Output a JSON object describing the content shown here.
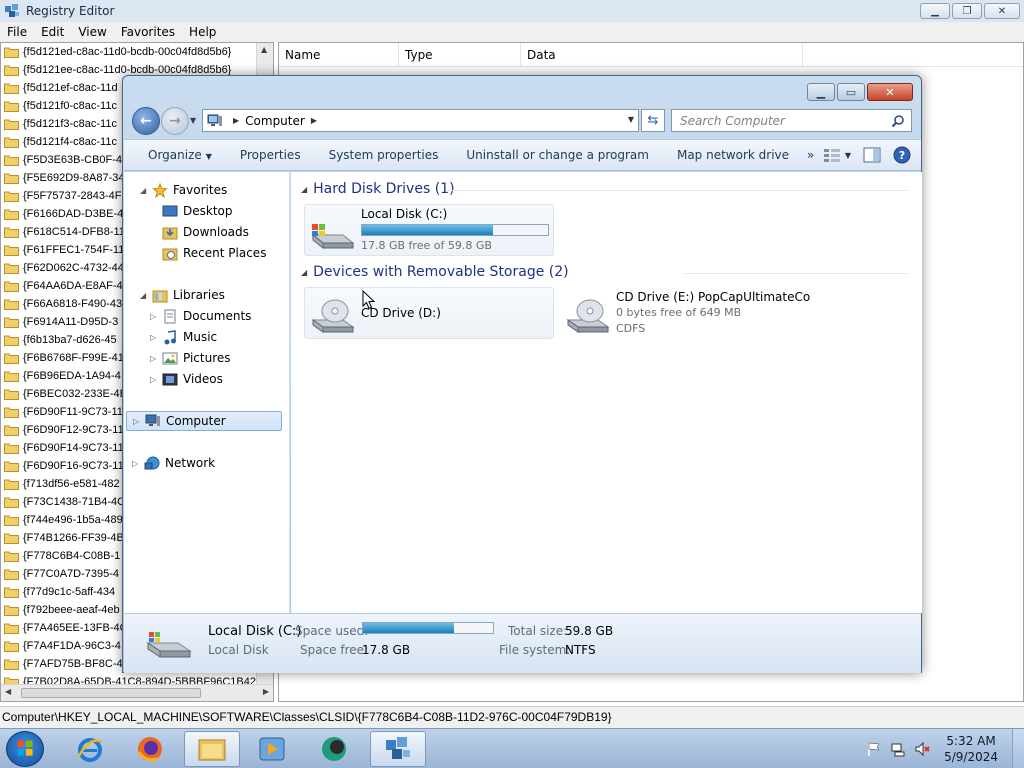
{
  "regedit": {
    "title": "Registry Editor",
    "menu": [
      "File",
      "Edit",
      "View",
      "Favorites",
      "Help"
    ],
    "tree_items": [
      "{f5d121ed-c8ac-11d0-bcdb-00c04fd8d5b6}",
      "{f5d121ee-c8ac-11d0-bcdb-00c04fd8d5b6}",
      "{f5d121ef-c8ac-11d",
      "{f5d121f0-c8ac-11c",
      "{f5d121f3-c8ac-11c",
      "{f5d121f4-c8ac-11c",
      "{F5D3E63B-CB0F-4(",
      "{F5E692D9-8A87-34",
      "{F5F75737-2843-4F",
      "{F6166DAD-D3BE-4",
      "{F618C514-DFB8-11",
      "{F61FFEC1-754F-11",
      "{F62D062C-4732-44",
      "{F64AA6DA-E8AF-4",
      "{F66A6818-F490-43",
      "{F6914A11-D95D-3",
      "{f6b13ba7-d626-45",
      "{F6B6768F-F99E-41",
      "{F6B96EDA-1A94-4",
      "{F6BEC032-233E-4E",
      "{F6D90F11-9C73-11",
      "{F6D90F12-9C73-11",
      "{F6D90F14-9C73-11",
      "{F6D90F16-9C73-11",
      "{f713df56-e581-482",
      "{F73C1438-71B4-4C",
      "{f744e496-1b5a-489",
      "{F74B1266-FF39-4B",
      "{F778C6B4-C08B-1",
      "{F77C0A7D-7395-4",
      "{f77d9c1c-5aff-434",
      "{f792beee-aeaf-4eb",
      "{F7A465EE-13FB-4C",
      "{F7A4F1DA-96C3-4",
      "{F7AFD75B-BF8C-4",
      "{F7B02D8A-65DB-41C8-894D-5BBBF96C1B42"
    ],
    "list_columns": [
      "Name",
      "Type",
      "Data"
    ],
    "status_path": "Computer\\HKEY_LOCAL_MACHINE\\SOFTWARE\\Classes\\CLSID\\{F778C6B4-C08B-11D2-976C-00C04F79DB19}"
  },
  "explorer": {
    "address": "Computer",
    "search_placeholder": "Search Computer",
    "toolbar": [
      "Organize",
      "Properties",
      "System properties",
      "Uninstall or change a program",
      "Map network drive"
    ],
    "toolbar_overflow": "»",
    "nav": {
      "favorites": "Favorites",
      "desktop": "Desktop",
      "downloads": "Downloads",
      "recent": "Recent Places",
      "libraries": "Libraries",
      "documents": "Documents",
      "music": "Music",
      "pictures": "Pictures",
      "videos": "Videos",
      "computer": "Computer",
      "network": "Network"
    },
    "groups": {
      "hdd": "Hard Disk Drives (1)",
      "removable": "Devices with Removable Storage (2)"
    },
    "drives": {
      "c": {
        "name": "Local Disk (C:)",
        "free": "17.8 GB free of 59.8 GB",
        "used_fraction": 0.702
      },
      "d": {
        "name": "CD Drive (D:)"
      },
      "e": {
        "name": "CD Drive (E:) PopCapUltimateCo",
        "free": "0 bytes free of 649 MB",
        "fs": "CDFS"
      }
    },
    "details": {
      "name": "Local Disk (C:)",
      "type": "Local Disk",
      "space_used_label": "Space used:",
      "space_free_label": "Space free:",
      "space_free": "17.8 GB",
      "total_size_label": "Total size:",
      "total_size": "59.8 GB",
      "file_system_label": "File system:",
      "file_system": "NTFS",
      "used_fraction": 0.702
    }
  },
  "taskbar": {
    "time": "5:32 AM",
    "date": "5/9/2024"
  },
  "colors": {
    "group_header": "#1e3287",
    "bar_fill": "#1c7fb8",
    "selection": "#cfe2f8"
  }
}
